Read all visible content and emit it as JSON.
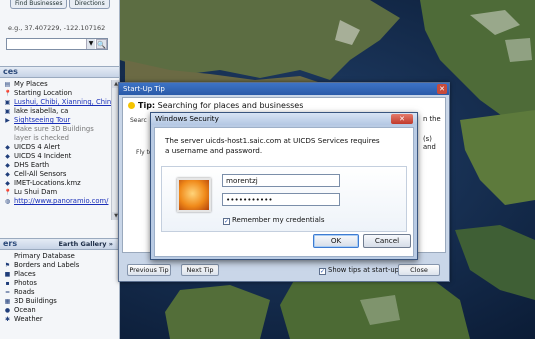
{
  "sidebar": {
    "tabs": [
      "Find Businesses",
      "Directions"
    ],
    "search_hint": "e.g., 37.407229, -122.107162",
    "places_header": "ces",
    "places_items": [
      {
        "label": "My Places",
        "icon": "folder-icon",
        "style": "normal"
      },
      {
        "label": "Starting Location",
        "icon": "pushpin-icon",
        "style": "normal"
      },
      {
        "label": "Lushui, Chibi, Xianning, Chin",
        "icon": "placemark-icon",
        "style": "link"
      },
      {
        "label": "lake isabella, ca",
        "icon": "placemark-icon",
        "style": "normal"
      },
      {
        "label": "Sightseeing Tour",
        "icon": "tour-icon",
        "style": "link"
      },
      {
        "label": "Make sure 3D Buildings",
        "icon": "",
        "style": "grey"
      },
      {
        "label": "layer is checked",
        "icon": "",
        "style": "grey"
      },
      {
        "label": "UICDS 4 Alert",
        "icon": "kml-icon",
        "style": "normal"
      },
      {
        "label": "UICDS 4 Incident",
        "icon": "kml-icon",
        "style": "normal"
      },
      {
        "label": "DHS Earth",
        "icon": "kml-icon",
        "style": "normal"
      },
      {
        "label": "Cell-All Sensors",
        "icon": "kml-icon",
        "style": "normal"
      },
      {
        "label": "IMET-Locations.kmz",
        "icon": "kml-icon",
        "style": "normal"
      },
      {
        "label": "Lu Shui Dam",
        "icon": "pushpin-icon",
        "style": "normal"
      },
      {
        "label": "http://www.panoramio.com/",
        "icon": "link-icon",
        "style": "link"
      }
    ],
    "layers_header": "ers",
    "earth_gallery": "Earth Gallery »",
    "layers_items": [
      {
        "label": "Primary Database",
        "icon": "",
        "style": "normal"
      },
      {
        "label": "Borders and Labels",
        "icon": "flag-icon",
        "style": "normal"
      },
      {
        "label": "Places",
        "icon": "places-icon",
        "style": "normal"
      },
      {
        "label": "Photos",
        "icon": "photo-icon",
        "style": "normal"
      },
      {
        "label": "Roads",
        "icon": "road-icon",
        "style": "normal"
      },
      {
        "label": "3D Buildings",
        "icon": "building-icon",
        "style": "normal"
      },
      {
        "label": "Ocean",
        "icon": "ocean-icon",
        "style": "normal"
      },
      {
        "label": "Weather",
        "icon": "weather-icon",
        "style": "normal"
      }
    ]
  },
  "startup_tip": {
    "title": "Start-Up Tip",
    "tip_label": "Tip:",
    "tip_text": "Searching for places and businesses",
    "right_text_1": "n the",
    "right_text_2": "(s) and",
    "search_fragment": "Searc",
    "fly_fragment": "Fly to",
    "previous_tip": "Previous Tip",
    "next_tip": "Next Tip",
    "show_tips": "Show tips at start-up",
    "show_tips_checked": true,
    "close_button": "Close"
  },
  "windows_security": {
    "title": "Windows Security",
    "message": "The server uicds-host1.saic.com at UICDS Services requires a username and password.",
    "username_value": "morentzj",
    "password_value": "•••••••••••",
    "remember_label": "Remember my credentials",
    "remember_checked": true,
    "ok_label": "OK",
    "cancel_label": "Cancel"
  }
}
